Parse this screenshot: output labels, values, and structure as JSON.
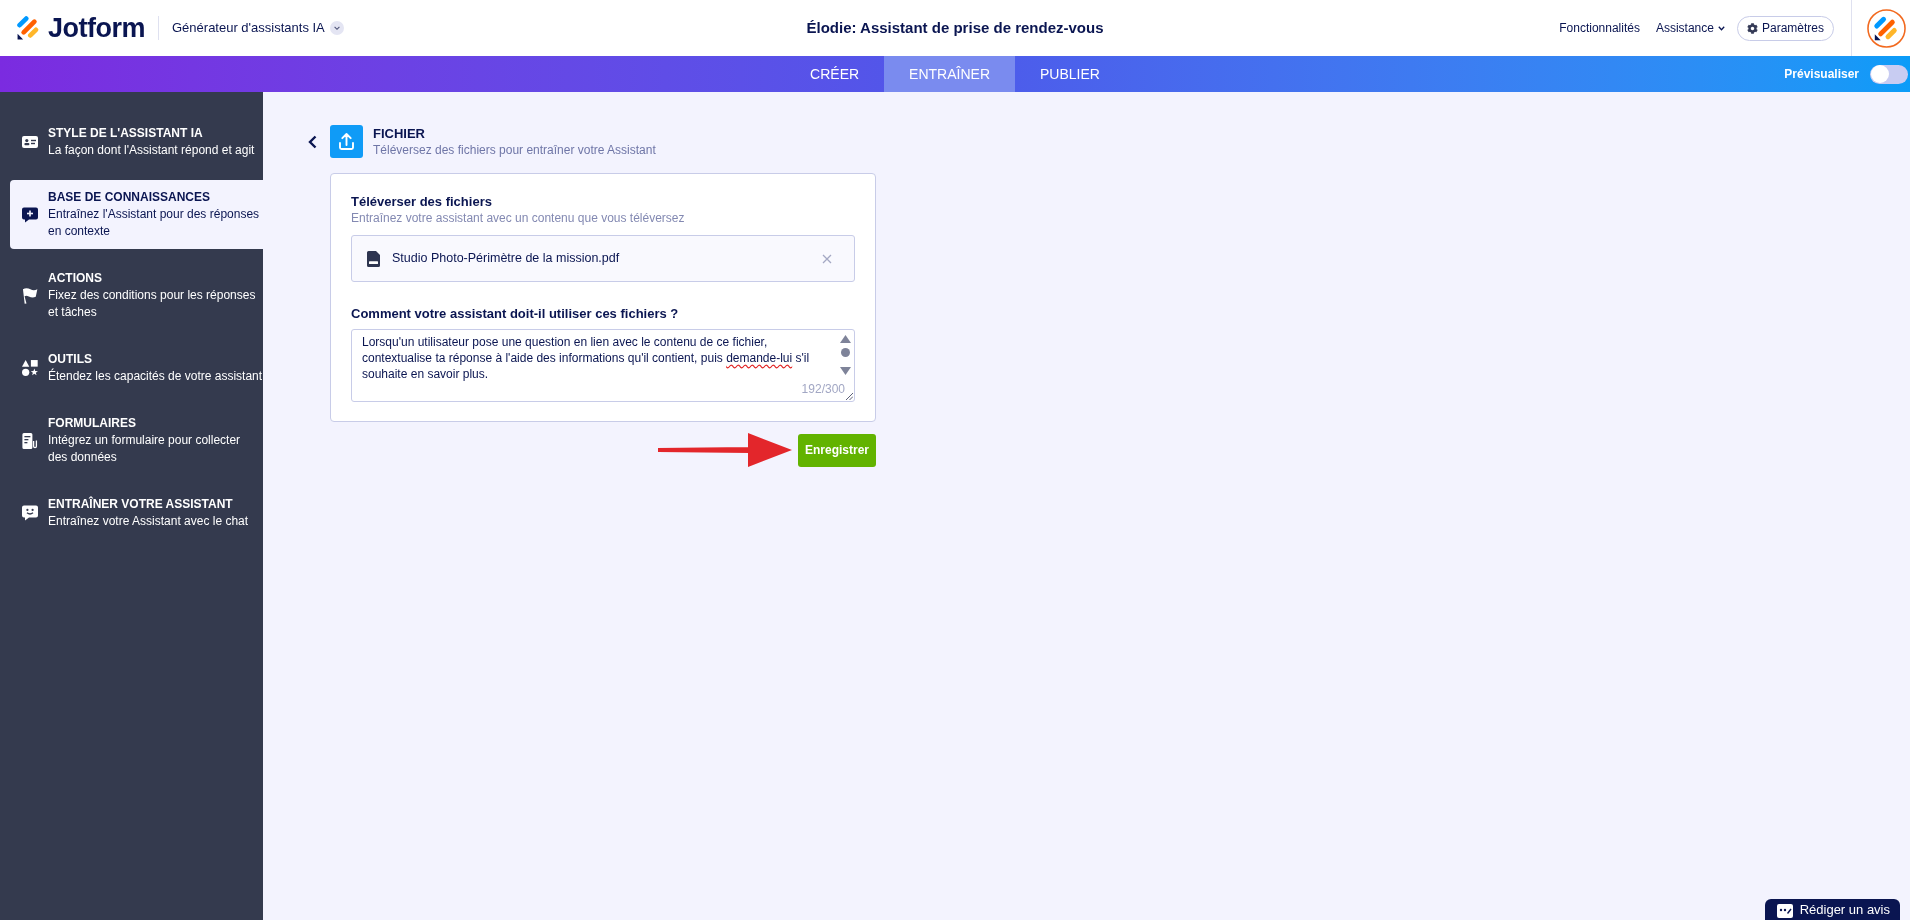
{
  "header": {
    "logo_text": "Jotform",
    "product_menu": "Générateur d'assistants IA",
    "title": "Élodie: Assistant de prise de rendez-vous",
    "links": [
      {
        "label": "Fonctionnalités",
        "kind": "link"
      },
      {
        "label": "Assistance",
        "kind": "dropdown"
      }
    ],
    "settings_button": "Paramètres"
  },
  "tabs": [
    {
      "label": "CRÉER",
      "selected": false
    },
    {
      "label": "ENTRAÎNER",
      "selected": true
    },
    {
      "label": "PUBLIER",
      "selected": false
    }
  ],
  "preview": {
    "label": "Prévisualiser",
    "on": false
  },
  "sidebar": {
    "items": [
      {
        "title": "STYLE DE L'ASSISTANT IA",
        "subtitle": "La façon dont l'Assistant répond et agit",
        "selected": false
      },
      {
        "title": "BASE DE CONNAISSANCES",
        "subtitle": "Entraînez l'Assistant pour des réponses en contexte",
        "selected": true
      },
      {
        "title": "ACTIONS",
        "subtitle": "Fixez des conditions pour les réponses et tâches",
        "selected": false
      },
      {
        "title": "OUTILS",
        "subtitle": "Étendez les capacités de votre assistant",
        "selected": false
      },
      {
        "title": "FORMULAIRES",
        "subtitle": "Intégrez un formulaire pour collecter des données",
        "selected": false
      },
      {
        "title": "ENTRAÎNER VOTRE ASSISTANT",
        "subtitle": "Entraînez votre Assistant avec le chat",
        "selected": false
      }
    ]
  },
  "section": {
    "title": "FICHIER",
    "subtitle": "Téléversez des fichiers pour entraîner votre Assistant"
  },
  "upload_card": {
    "title": "Téléverser des fichiers",
    "subtitle": "Entraînez votre assistant avec un contenu que vous téléversez",
    "files": [
      {
        "name": "Studio Photo-Périmètre de la mission.pdf"
      }
    ],
    "question": "Comment votre assistant doit-il utiliser ces fichiers ?",
    "instructions": {
      "segments": [
        {
          "text": "Lorsqu'un utilisateur pose une question en lien avec le contenu de ce fichier, contextualise ta réponse à l'aide des informations qu'il contient, puis ",
          "misspelled": false
        },
        {
          "text": "demande-lui",
          "misspelled": true
        },
        {
          "text": " s'il souhaite en savoir plus.",
          "misspelled": false
        }
      ],
      "counter": "192/300"
    }
  },
  "save_button": "Enregistrer",
  "feedback_button": "Rédiger un avis"
}
